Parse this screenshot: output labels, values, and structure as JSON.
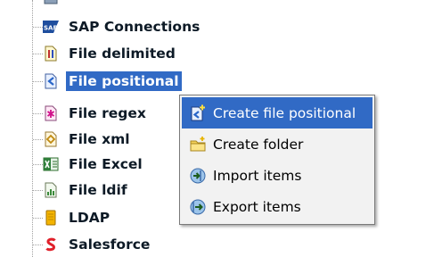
{
  "tree": {
    "items": [
      {
        "label": "SAP Connections",
        "icon": "sap-icon"
      },
      {
        "label": "File delimited",
        "icon": "file-delimited-icon"
      },
      {
        "label": "File positional",
        "icon": "file-positional-icon",
        "selected": true
      },
      {
        "label": "File regex",
        "icon": "file-regex-icon"
      },
      {
        "label": "File xml",
        "icon": "file-xml-icon"
      },
      {
        "label": "File Excel",
        "icon": "file-excel-icon"
      },
      {
        "label": "File ldif",
        "icon": "file-ldif-icon"
      },
      {
        "label": "LDAP",
        "icon": "ldap-icon"
      },
      {
        "label": "Salesforce",
        "icon": "salesforce-icon"
      }
    ]
  },
  "context_menu": {
    "items": [
      {
        "label": "Create file positional",
        "icon": "create-file-positional-icon",
        "active": true
      },
      {
        "label": "Create folder",
        "icon": "create-folder-icon"
      },
      {
        "label": "Import items",
        "icon": "import-items-icon"
      },
      {
        "label": "Export items",
        "icon": "export-items-icon"
      }
    ]
  },
  "colors": {
    "selection": "#316ac5",
    "menu_background": "#f2f2f2",
    "tree_text": "#0d1a26"
  }
}
